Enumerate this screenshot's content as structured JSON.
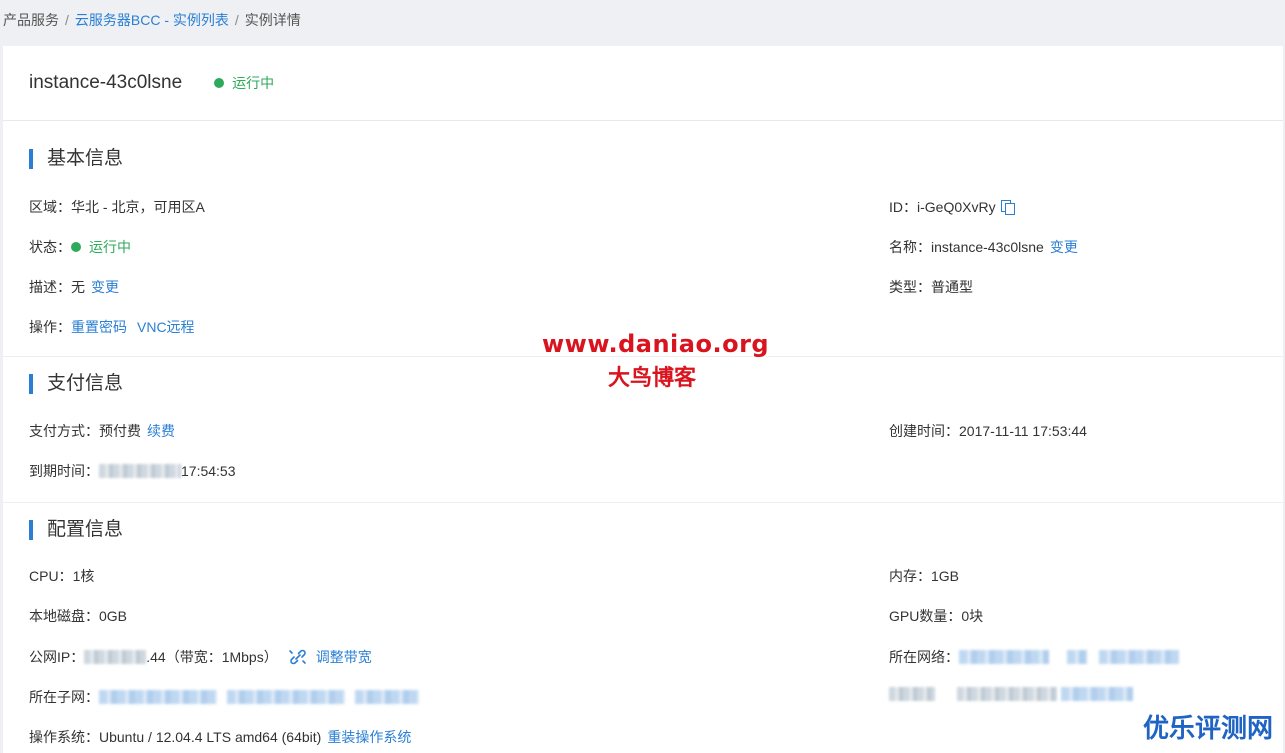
{
  "breadcrumb": {
    "items": [
      "产品服务",
      "云服务器BCC - 实例列表",
      "实例详情"
    ],
    "separator": "/"
  },
  "header": {
    "instance_name": "instance-43c0lsne",
    "status": "运行中"
  },
  "basic": {
    "title": "基本信息",
    "region_label": "区域：",
    "region_value": "华北 - 北京，可用区A",
    "id_label": "ID：",
    "id_value": "i-GeQ0XvRy",
    "status_label": "状态：",
    "status_value": "运行中",
    "name_label": "名称：",
    "name_value": "instance-43c0lsne",
    "name_change": "变更",
    "desc_label": "描述：",
    "desc_value": "无",
    "desc_change": "变更",
    "type_label": "类型：",
    "type_value": "普通型",
    "ops_label": "操作：",
    "ops_reset": "重置密码",
    "ops_vnc": "VNC远程"
  },
  "payment": {
    "title": "支付信息",
    "method_label": "支付方式：",
    "method_value": "预付费",
    "renew": "续费",
    "created_label": "创建时间：",
    "created_value": "2017-11-11 17:53:44",
    "expire_label": "到期时间：",
    "expire_tail": "17:54:53"
  },
  "config": {
    "title": "配置信息",
    "cpu_label": "CPU：",
    "cpu_value": "1核",
    "mem_label": "内存：",
    "mem_value": "1GB",
    "disk_label": "本地磁盘：",
    "disk_value": "0GB",
    "gpu_label": "GPU数量：",
    "gpu_value": "0块",
    "ip_label": "公网IP：",
    "ip_tail": ".44",
    "bandwidth": "（带宽：1Mbps）",
    "adjust_bw": "调整带宽",
    "network_label": "所在网络：",
    "subnet_label": "所在子网：",
    "os_label": "操作系统：",
    "os_value": "Ubuntu / 12.04.4 LTS amd64 (64bit)",
    "os_reinstall": "重装操作系统"
  },
  "watermark": {
    "url": "www.daniao.org",
    "name": "大鸟博客",
    "corner": "优乐评测网"
  },
  "colors": {
    "accent": "#2a7fd4",
    "running": "#2eaa5a",
    "watermark": "#d9141e"
  }
}
